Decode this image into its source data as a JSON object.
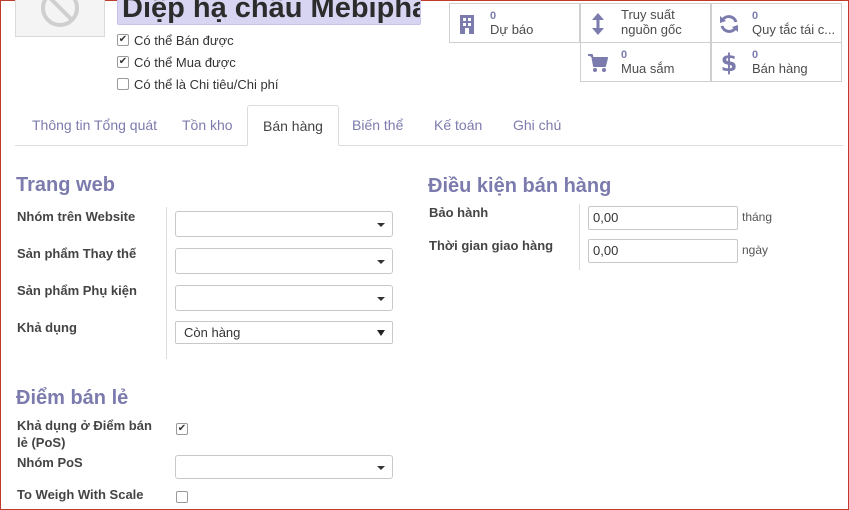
{
  "product": {
    "name": "Diệp hạ châu Mebiphar",
    "image_icon": "no-image-icon"
  },
  "options": {
    "can_be_sold": {
      "label": "Có thể Bán được",
      "checked": true
    },
    "can_be_purchased": {
      "label": "Có thể Mua được",
      "checked": true
    },
    "can_be_expensed": {
      "label": "Có thể là Chi tiêu/Chi phí",
      "checked": false
    }
  },
  "smart_buttons": [
    {
      "icon": "building-icon",
      "count": "0",
      "label": "Dự báo"
    },
    {
      "icon": "arrows-updown-icon",
      "label": "Truy suất nguồn gốc"
    },
    {
      "icon": "refresh-icon",
      "count": "0",
      "label": "Quy tắc tái c..."
    },
    {
      "icon": "cart-icon",
      "count": "0",
      "label": "Mua sắm"
    },
    {
      "icon": "dollar-icon",
      "count": "0",
      "label": "Bán hàng"
    }
  ],
  "tabs": [
    {
      "label": "Thông tin Tổng quát",
      "active": false
    },
    {
      "label": "Tồn kho",
      "active": false
    },
    {
      "label": "Bán hàng",
      "active": true
    },
    {
      "label": "Biến thể",
      "active": false
    },
    {
      "label": "Kế toán",
      "active": false
    },
    {
      "label": "Ghi chú",
      "active": false
    }
  ],
  "website": {
    "title": "Trang web",
    "fields": {
      "group": {
        "label": "Nhóm trên Website",
        "value": ""
      },
      "alternative": {
        "label": "Sản phẩm Thay thế",
        "value": ""
      },
      "accessory": {
        "label": "Sản phẩm Phụ kiện",
        "value": ""
      },
      "availability": {
        "label": "Khả dụng",
        "value": "Còn hàng"
      }
    }
  },
  "sale_conditions": {
    "title": "Điều kiện bán hàng",
    "warranty": {
      "label": "Bảo hành",
      "value": "0,00",
      "unit": "tháng"
    },
    "lead_time": {
      "label": "Thời gian giao hàng",
      "value": "0,00",
      "unit": "ngày"
    }
  },
  "pos": {
    "title": "Điểm bán lẻ",
    "available": {
      "label": "Khả dụng ở Điểm bán lẻ (PoS)",
      "checked": true
    },
    "category": {
      "label": "Nhóm PoS",
      "value": ""
    },
    "to_weigh": {
      "label": "To Weigh With Scale",
      "checked": false
    }
  },
  "colors": {
    "accent": "#7c7bad",
    "name_field_bg": "#d8d5f2"
  }
}
